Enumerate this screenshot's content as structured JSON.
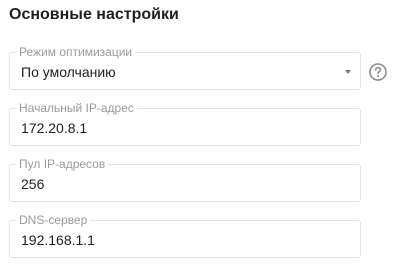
{
  "section": {
    "title": "Основные настройки"
  },
  "fields": {
    "optimization_mode": {
      "label": "Режим оптимизации",
      "value": "По умолчанию"
    },
    "start_ip": {
      "label": "Начальный IP-адрес",
      "value": "172.20.8.1"
    },
    "ip_pool": {
      "label": "Пул IP-адресов",
      "value": "256"
    },
    "dns_server": {
      "label": "DNS-сервер",
      "value": "192.168.1.1"
    }
  },
  "icons": {
    "select": "chevron-down-icon",
    "help": "help-icon"
  },
  "colors": {
    "border": "#e4e4e4",
    "label": "#9a9a9a",
    "text": "#1f1f1f",
    "icon": "#8a8a8a"
  }
}
